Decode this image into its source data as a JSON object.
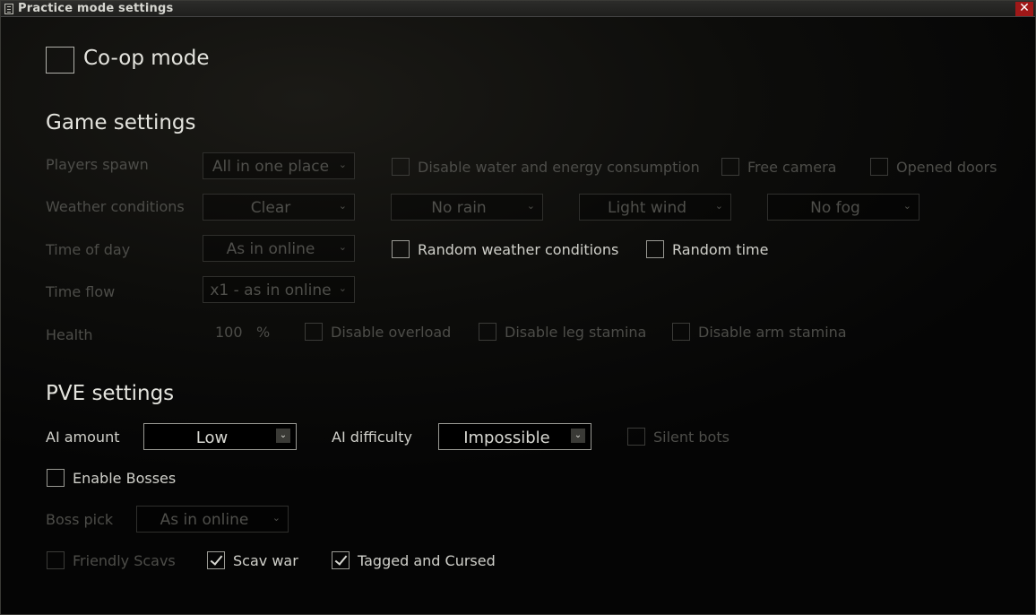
{
  "window": {
    "title": "Practice mode settings",
    "close_glyph": "✕"
  },
  "coop": {
    "label": "Co-op mode",
    "checked": false
  },
  "game_settings": {
    "heading": "Game settings",
    "players_spawn": {
      "label": "Players spawn",
      "value": "All in one place"
    },
    "disable_water": "Disable water and energy consumption",
    "free_camera": "Free camera",
    "opened_doors": "Opened doors",
    "weather": {
      "label": "Weather conditions",
      "clouds": "Clear",
      "rain": "No rain",
      "wind": "Light wind",
      "fog": "No fog"
    },
    "time_of_day": {
      "label": "Time of day",
      "value": "As in online"
    },
    "random_weather": "Random weather conditions",
    "random_time": "Random time",
    "time_flow": {
      "label": "Time flow",
      "value": "x1 - as in online"
    },
    "health": {
      "label": "Health",
      "value": "100",
      "unit": "%"
    },
    "disable_overload": "Disable overload",
    "disable_leg_stamina": "Disable leg stamina",
    "disable_arm_stamina": "Disable arm stamina"
  },
  "pve_settings": {
    "heading": "PVE settings",
    "ai_amount": {
      "label": "AI amount",
      "value": "Low"
    },
    "ai_difficulty": {
      "label": "AI difficulty",
      "value": "Impossible"
    },
    "silent_bots": "Silent bots",
    "enable_bosses": "Enable Bosses",
    "boss_pick": {
      "label": "Boss pick",
      "value": "As in online"
    },
    "friendly_scavs": "Friendly Scavs",
    "scav_war": {
      "label": "Scav war",
      "checked": true
    },
    "tagged_cursed": {
      "label": "Tagged and Cursed",
      "checked": true
    }
  },
  "icons": {
    "dropdown_arrow": "chevron-down-icon",
    "app": "document-icon",
    "close": "close-icon"
  }
}
